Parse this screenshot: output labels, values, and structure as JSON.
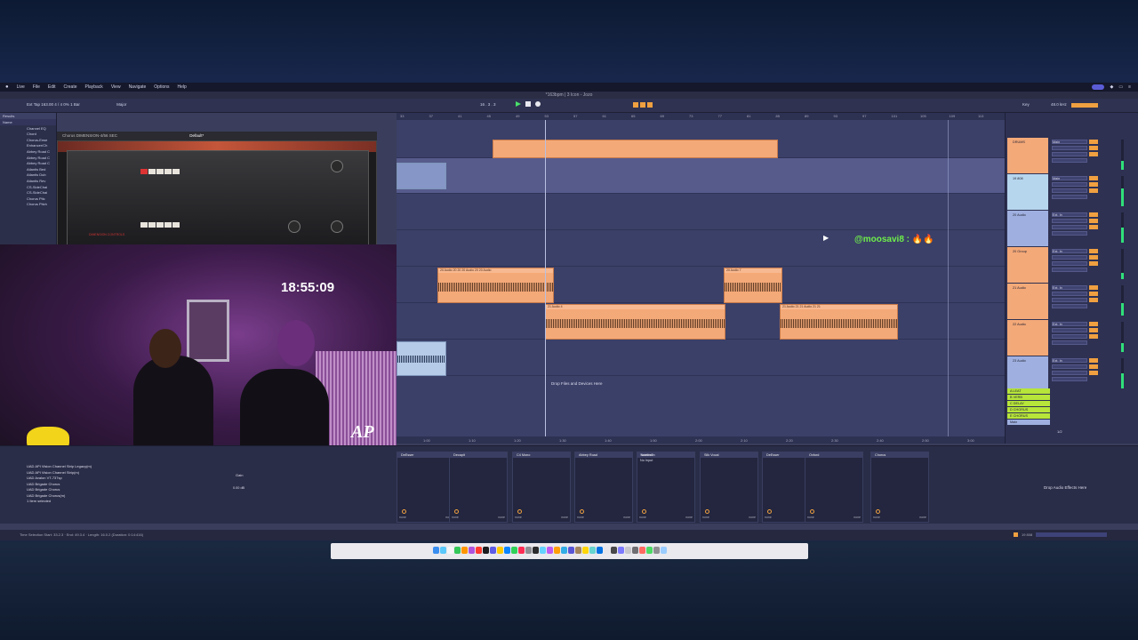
{
  "menubar": {
    "apple": "",
    "items": [
      "Live",
      "File",
      "Edit",
      "Create",
      "Playback",
      "View",
      "Navigate",
      "Options",
      "Help"
    ]
  },
  "titlebar": {
    "title": "*163bpm | 3 Icon - Jozo"
  },
  "controlbar": {
    "exit": "Ext",
    "tap": "Tap",
    "tempo": "163.00",
    "signature": "4 / 4",
    "zoom": "0%",
    "bar": "1 Bar",
    "key": "Major",
    "position": "16 . 3 . 3",
    "key_label": "Key",
    "cpu": "48.0 kHz",
    "cpu_pct": "5 %"
  },
  "browser": {
    "search": "Results",
    "section": "Name",
    "items": [
      "Channel EQ",
      "Chord",
      "Chorus-Ense",
      "Enhancer/Ch",
      "Abbey Road C",
      "Abbey Road C",
      "Abbey Road C",
      "Atlantis Bed",
      "Atlantis Dub",
      "Atlantis Rev",
      "CS-SideChai",
      "CS-SideChai",
      "Chorus Pitc",
      "Chorus Pitch"
    ]
  },
  "plugin": {
    "title": "Chorus DIMENSION-4/56 SEC",
    "preset": "Default*",
    "brand": "DIMENSION CONTROLS",
    "labels": [
      "MODE",
      "DIMENSION MODE",
      "OUTPUT LEVEL",
      "OSCILLATOR RATE",
      "DYNAMIC COLOR",
      "DEPTH",
      "MIX",
      "POWER"
    ]
  },
  "webcam": {
    "time": "18:55:09",
    "logo": "AP"
  },
  "arrangement": {
    "ruler": [
      "33",
      "37",
      "41",
      "45",
      "49",
      "53",
      "57",
      "61",
      "65",
      "69",
      "73",
      "77",
      "81",
      "85",
      "89",
      "93",
      "97",
      "101",
      "105",
      "109",
      "113",
      "117"
    ],
    "handle": "@moosavi8 : 🔥🔥",
    "drop_text": "Drop Files and Devices Here",
    "timeline": [
      "1:00",
      "1:10",
      "1:20",
      "1:30",
      "1:40",
      "1:50",
      "2:00",
      "2:10",
      "2:20",
      "2:30",
      "2:40",
      "2:50",
      "3:00"
    ],
    "clips": [
      {
        "label": "",
        "lane": "top"
      },
      {
        "label": "20 Audio 20 20 20 Audio 20 20 Audio",
        "lane": "a"
      },
      {
        "label": "20 Audio 7",
        "lane": "a"
      },
      {
        "label": "21 Audio 4",
        "lane": "b"
      },
      {
        "label": "21 Audio 21 21 Audio 21 21",
        "lane": "b"
      }
    ]
  },
  "mixer": {
    "tracks": [
      {
        "name": "DRUMS",
        "color": "#f4a978",
        "route": "Main"
      },
      {
        "name": "19 808",
        "color": "#b6d6ee",
        "route": "Main"
      },
      {
        "name": "20 Audio",
        "color": "#9fb0e0",
        "route": "Ext. In"
      },
      {
        "name": "20 Group",
        "color": "#f4a978",
        "route": "Ext. In"
      },
      {
        "name": "21 Audio",
        "color": "#f4a978",
        "route": "Ext. In"
      },
      {
        "name": "22 Audio",
        "color": "#f4a978",
        "route": "Ext. In"
      },
      {
        "name": "23 Audio",
        "color": "#9fb0e0",
        "route": "Ext. In"
      }
    ],
    "returns": [
      "A LEAT",
      "B VERB",
      "C DELAY",
      "D CHORUS",
      "E CHORUS",
      "Main"
    ],
    "master_label": "1/2"
  },
  "devices": {
    "browser_items": [
      "UAD API Vision Channel Strip Legacy(m)",
      "UAD API Vision Channel Strip(m)",
      "UAD Avalon VT-737sp",
      "UAD Brigade Chorus",
      "UAD Brigade Chorus",
      "UAD Brigade Chorus(m)",
      "1 Item selected"
    ],
    "slots": [
      "DeEsser",
      "Decapit",
      "C4 Mono",
      "Abbey Road",
      "soothe2",
      "Silk Vocal",
      "DeEsser",
      "Oxford",
      "Chorus"
    ],
    "slot_sel": "none",
    "gain_label": "Gain",
    "gain_value": "0.00 dB",
    "sidechain_label": "Sidechain",
    "no_input": "No Input",
    "fx_drop": "Drop Audio Effects Here"
  },
  "statusbar": {
    "text": "Time Selection  Start: 33.2.3 · End: 49.3.4 · Length: 16.0.2 (Duration: 0:14:416)",
    "right": "19 808"
  },
  "colors": {
    "clip": "#f4a978",
    "accent": "#f0a040",
    "handle": "#6ef04a",
    "meter": "#2fe07a"
  }
}
